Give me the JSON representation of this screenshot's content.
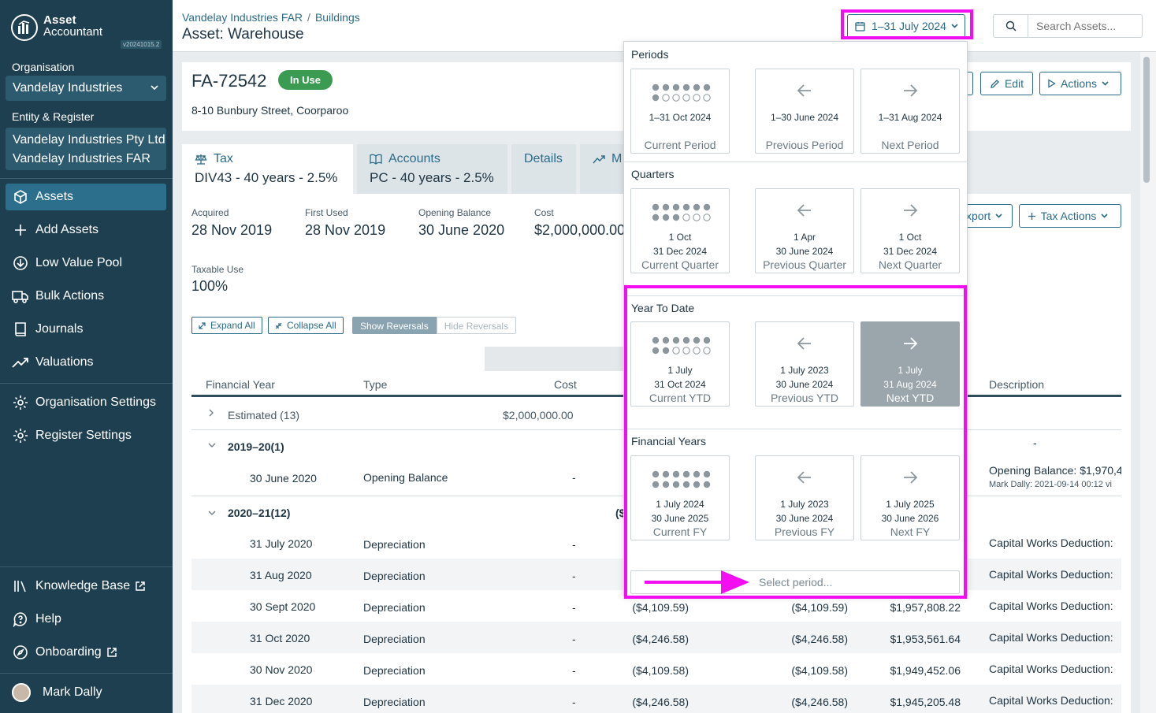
{
  "sidebar": {
    "logo_line1": "Asset",
    "logo_line2": "Accountant",
    "version": "v20241015.2",
    "organisation_label": "Organisation",
    "organisation_value": "Vandelay Industries",
    "entity_label": "Entity & Register",
    "entity_line1": "Vandelay Industries Pty Ltd",
    "entity_line2": "Vandelay Industries FAR",
    "nav": [
      {
        "label": "Assets",
        "icon": "cube-icon"
      },
      {
        "label": "Add Assets",
        "icon": "plus-icon"
      },
      {
        "label": "Low Value Pool",
        "icon": "download-circle-icon"
      },
      {
        "label": "Bulk Actions",
        "icon": "truck-icon"
      },
      {
        "label": "Journals",
        "icon": "book-icon"
      },
      {
        "label": "Valuations",
        "icon": "trend-icon"
      },
      {
        "label": "Organisation Settings",
        "icon": "gear-icon"
      },
      {
        "label": "Register Settings",
        "icon": "gear-icon"
      }
    ],
    "bottom_nav": [
      {
        "label": "Knowledge Base",
        "icon": "library-icon"
      },
      {
        "label": "Help",
        "icon": "help-bubble-icon"
      },
      {
        "label": "Onboarding",
        "icon": "compass-icon"
      }
    ],
    "user_name": "Mark Dally"
  },
  "header": {
    "breadcrumb": [
      "Vandelay Industries FAR",
      "Buildings"
    ],
    "breadcrumb_sep": "/",
    "title": "Asset: Warehouse",
    "date_range": "1–31 July 2024",
    "search_placeholder": "Search Assets..."
  },
  "asset": {
    "id": "FA-72542",
    "status": "In Use",
    "address": "8-10 Bunbury Street, Coorparoo",
    "edit_label": "Edit",
    "actions_label": "Actions"
  },
  "tabs": [
    {
      "title": "Tax",
      "subtitle": "DIV43 - 40 years - 2.5%"
    },
    {
      "title": "Accounts",
      "subtitle": "PC - 40 years - 2.5%"
    },
    {
      "title": "Details",
      "subtitle": ""
    },
    {
      "title": "M",
      "subtitle": ""
    }
  ],
  "fields": {
    "acquired_label": "Acquired",
    "acquired": "28 Nov 2019",
    "first_used_label": "First Used",
    "first_used": "28 Nov 2019",
    "opening_label": "Opening Balance",
    "opening": "30 June 2020",
    "cost_label": "Cost",
    "cost": "$2,000,000.00",
    "taxable_label": "Taxable Use",
    "taxable": "100%"
  },
  "toolbar": {
    "expand_all": "Expand All",
    "collapse_all": "Collapse All",
    "show_reversals": "Show Reversals",
    "hide_reversals": "Hide Reversals",
    "export": "xport",
    "tax_actions": "Tax Actions"
  },
  "table": {
    "headers": {
      "fy": "Financial Year",
      "type": "Type",
      "cost": "Cost",
      "desc": "Description"
    },
    "estimated": {
      "label": "Estimated",
      "count": "(13)",
      "cost": "$2,000,000.00",
      "desc": "-"
    },
    "group1": {
      "label": "2019–20",
      "count": "(1)"
    },
    "opening_row": {
      "date": "30 June 2020",
      "type": "Opening Balance",
      "cost": "-",
      "desc": "Opening Balance: $1,970,4",
      "sub": "Mark Dally: 2021-09-14 00:12 vi"
    },
    "group2": {
      "label": "2020–21",
      "count": "(12)",
      "partial": "($"
    },
    "rows": [
      {
        "date": "31 July 2020",
        "type": "Depreciation",
        "cost": "-",
        "dep": "",
        "dep2": "",
        "bal": "",
        "desc": "Capital Works Deduction:"
      },
      {
        "date": "31 Aug 2020",
        "type": "Depreciation",
        "cost": "-",
        "dep": "",
        "dep2": "",
        "bal": "",
        "desc": "Capital Works Deduction:"
      },
      {
        "date": "30 Sept 2020",
        "type": "Depreciation",
        "cost": "-",
        "dep": "($4,109.59)",
        "dep2": "($4,109.59)",
        "bal": "$1,957,808.22",
        "desc": "Capital Works Deduction:"
      },
      {
        "date": "31 Oct 2020",
        "type": "Depreciation",
        "cost": "-",
        "dep": "($4,246.58)",
        "dep2": "($4,246.58)",
        "bal": "$1,953,561.64",
        "desc": "Capital Works Deduction:"
      },
      {
        "date": "30 Nov 2020",
        "type": "Depreciation",
        "cost": "-",
        "dep": "($4,109.58)",
        "dep2": "($4,109.58)",
        "bal": "$1,949,452.06",
        "desc": "Capital Works Deduction:"
      },
      {
        "date": "31 Dec 2020",
        "type": "Depreciation",
        "cost": "-",
        "dep": "($4,246.58)",
        "dep2": "($4,246.58)",
        "bal": "$1,945,205.48",
        "desc": "Capital Works Deduction:"
      }
    ]
  },
  "dropdown": {
    "sections": [
      {
        "title": "Periods",
        "cards": [
          {
            "l1": "1–31 Oct 2024",
            "l2": "",
            "caption": "Current Period",
            "filled": 7,
            "selected": false
          },
          {
            "l1": "1–30 June 2024",
            "l2": "",
            "caption": "Previous Period",
            "selected": false
          },
          {
            "l1": "1–31 Aug 2024",
            "l2": "",
            "caption": "Next Period",
            "selected": false
          }
        ]
      },
      {
        "title": "Quarters",
        "cards": [
          {
            "l1": "1 Oct",
            "l2": "31 Dec 2024",
            "caption": "Current Quarter",
            "selected": false
          },
          {
            "l1": "1 Apr",
            "l2": "30 June 2024",
            "caption": "Previous Quarter",
            "selected": false
          },
          {
            "l1": "1 Oct",
            "l2": "31 Dec 2024",
            "caption": "Next Quarter",
            "selected": false
          }
        ]
      },
      {
        "title": "Year To Date",
        "cards": [
          {
            "l1": "1 July",
            "l2": "31 Oct 2024",
            "caption": "Current YTD",
            "selected": false
          },
          {
            "l1": "1 July 2023",
            "l2": "30 June 2024",
            "caption": "Previous YTD",
            "selected": false
          },
          {
            "l1": "1 July",
            "l2": "31 Aug 2024",
            "caption": "Next YTD",
            "selected": true
          }
        ]
      },
      {
        "title": "Financial Years",
        "cards": [
          {
            "l1": "1 July 2024",
            "l2": "30 June 2025",
            "caption": "Current FY",
            "selected": false
          },
          {
            "l1": "1 July 2023",
            "l2": "30 June 2024",
            "caption": "Previous FY",
            "selected": false
          },
          {
            "l1": "1 July 2025",
            "l2": "30 June 2026",
            "caption": "Next FY",
            "selected": false
          }
        ]
      }
    ],
    "select_placeholder": "Select period..."
  },
  "colors": {
    "sidebar": "#1e3f50",
    "accent": "#2a6b88",
    "highlight": "#f20ef1",
    "badge": "#3c9b52"
  }
}
